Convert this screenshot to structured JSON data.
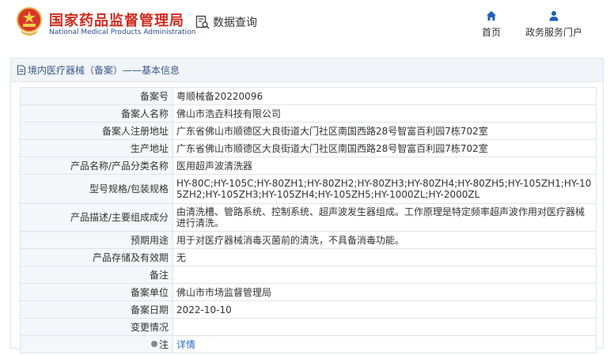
{
  "header": {
    "title_cn": "国家药品监督管理局",
    "title_en": "National Medical Products Administration",
    "query_label": "数据查询",
    "nav": [
      {
        "label": "首页",
        "icon": "home-icon"
      },
      {
        "label": "政务服务门户",
        "icon": "user-icon"
      }
    ]
  },
  "panel": {
    "heading": "境内医疗器械（备案）——基本信息"
  },
  "rows": [
    {
      "label": "备案号",
      "value": "粤顺械备20220096"
    },
    {
      "label": "备案人名称",
      "value": "佛山市浩垚科技有限公司"
    },
    {
      "label": "备案人注册地址",
      "value": "广东省佛山市顺德区大良街道大门社区南国西路28号智富百利园7栋702室"
    },
    {
      "label": "生产地址",
      "value": "广东省佛山市顺德区大良街道大门社区南国西路28号智富百利园7栋702室"
    },
    {
      "label": "产品名称/产品分类名称",
      "value": "医用超声波清洗器"
    },
    {
      "label": "型号规格/包装规格",
      "value": "HY-80C;HY-105C;HY-80ZH1;HY-80ZH2;HY-80ZH3;HY-80ZH4;HY-80ZH5;HY-105ZH1;HY-105ZH2;HY-105ZH3;HY-105ZH4;HY-105ZH5;HY-1000ZL;HY-2000ZL"
    },
    {
      "label": "产品描述/主要组成成分",
      "value": "由清洗槽、管路系统、控制系统、超声波发生器组成。工作原理是特定频率超声波作用对医疗器械进行清洗。"
    },
    {
      "label": "预期用途",
      "value": "用于对医疗器械消毒灭菌前的清洗，不具备消毒功能。"
    },
    {
      "label": "产品存储及有效期",
      "value": "无"
    },
    {
      "label": "备注",
      "value": ""
    },
    {
      "label": "备案单位",
      "value": "佛山市市场监督管理局"
    },
    {
      "label": "备案日期",
      "value": "2022-10-10"
    },
    {
      "label": "变更情况",
      "value": ""
    },
    {
      "label": "注",
      "value": "详情"
    }
  ],
  "colors": {
    "brand_red": "#d32a1e",
    "brand_blue": "#2a4d8f",
    "link": "#2a6cc7",
    "label_bg": "#f5f7fa"
  }
}
